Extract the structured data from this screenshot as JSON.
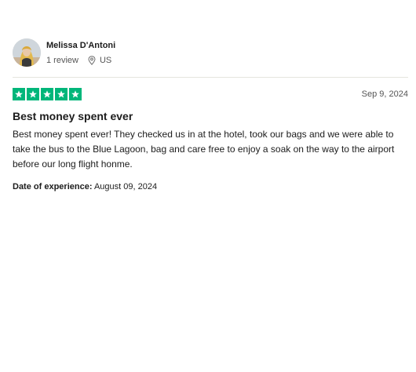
{
  "reviewer": {
    "name": "Melissa D'Antoni",
    "review_count": "1 review",
    "country": "US"
  },
  "review": {
    "rating": 5,
    "rating_max": 5,
    "date": "Sep 9, 2024",
    "title": "Best money spent ever",
    "body": "Best money spent ever! They checked us in at the hotel, took our bags and we were able to take the bus to the Blue Lagoon, bag and care free to enjoy a soak on the way to the airport before our long flight honme.",
    "experience_label": "Date of experience:",
    "experience_date": "August 09, 2024"
  },
  "colors": {
    "star_green": "#00b67a",
    "text": "#1c1c1c",
    "muted": "#555555",
    "divider": "#e5e5dd"
  },
  "icons": {
    "location": "location-pin-icon",
    "star": "star-icon"
  }
}
